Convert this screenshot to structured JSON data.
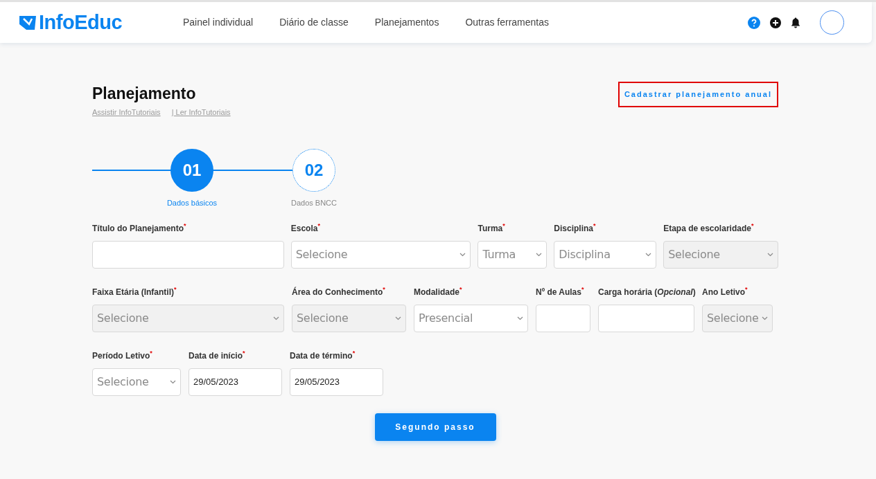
{
  "header": {
    "logo": "InfoEduc",
    "nav": [
      "Painel individual",
      "Diário de classe",
      "Planejamentos",
      "Outras ferramentas"
    ]
  },
  "page": {
    "title": "Planejamento",
    "links": [
      "Assistir InfoTutoriais",
      "| Ler InfoTutoriais"
    ],
    "action": {
      "label": "Cadastrar planejamento anual",
      "highlighted": true
    }
  },
  "steps": [
    {
      "number": "01",
      "label": "Dados básicos",
      "selected": true
    },
    {
      "number": "02",
      "label": "Dados BNCC",
      "selected": false
    }
  ],
  "form_rows": [
    [
      {
        "label": "Título do Planejamento$^{*}$",
        "kind": "text",
        "disabled": false
      },
      {
        "label": "Escola$^{*}$",
        "kind": "select",
        "placeholder": "Selecione",
        "disabled": false
      },
      {
        "label": "Turma$^{*}$",
        "kind": "select",
        "placeholder": "Turma",
        "disabled": false
      },
      {
        "label": "Disciplina$^{*}$",
        "kind": "select",
        "placeholder": "Disciplina",
        "disabled": false
      },
      {
        "label": "Etapa de escolaridade$^{*}$",
        "kind": "select",
        "placeholder": "Selecione",
        "disabled": true
      }
    ],
    [
      {
        "label": "Faixa Etária (Infantil)$^{*}$",
        "kind": "select",
        "placeholder": "Selecione",
        "disabled": true
      },
      {
        "label": "Área do Conhecimento$^{*}$",
        "kind": "select",
        "placeholder": "Selecione",
        "disabled": true
      },
      {
        "label": "Modalidade$^{*}$",
        "kind": "select",
        "placeholder": "Presencial",
        "disabled": false
      },
      {
        "label": "Nº de Aulas$^{*}$",
        "kind": "text",
        "disabled": false
      },
      {
        "label": "Carga horária (*Opcional*)",
        "kind": "text",
        "disabled": false
      },
      {
        "label": "Ano Letivo$^{*}$",
        "kind": "select",
        "placeholder": "Selecione",
        "disabled": true
      }
    ],
    [
      {
        "label": "Período Letivo$^{*}$",
        "kind": "select",
        "placeholder": "Selecione",
        "disabled": false
      },
      {
        "label": "Data de início$^{*}$",
        "kind": "date",
        "value": "29/05/2023",
        "disabled": false
      },
      {
        "label": "Data de término$^{*}$",
        "kind": "date",
        "value": "29/05/2023",
        "disabled": false
      }
    ]
  ],
  "submit": "Segundo passo"
}
